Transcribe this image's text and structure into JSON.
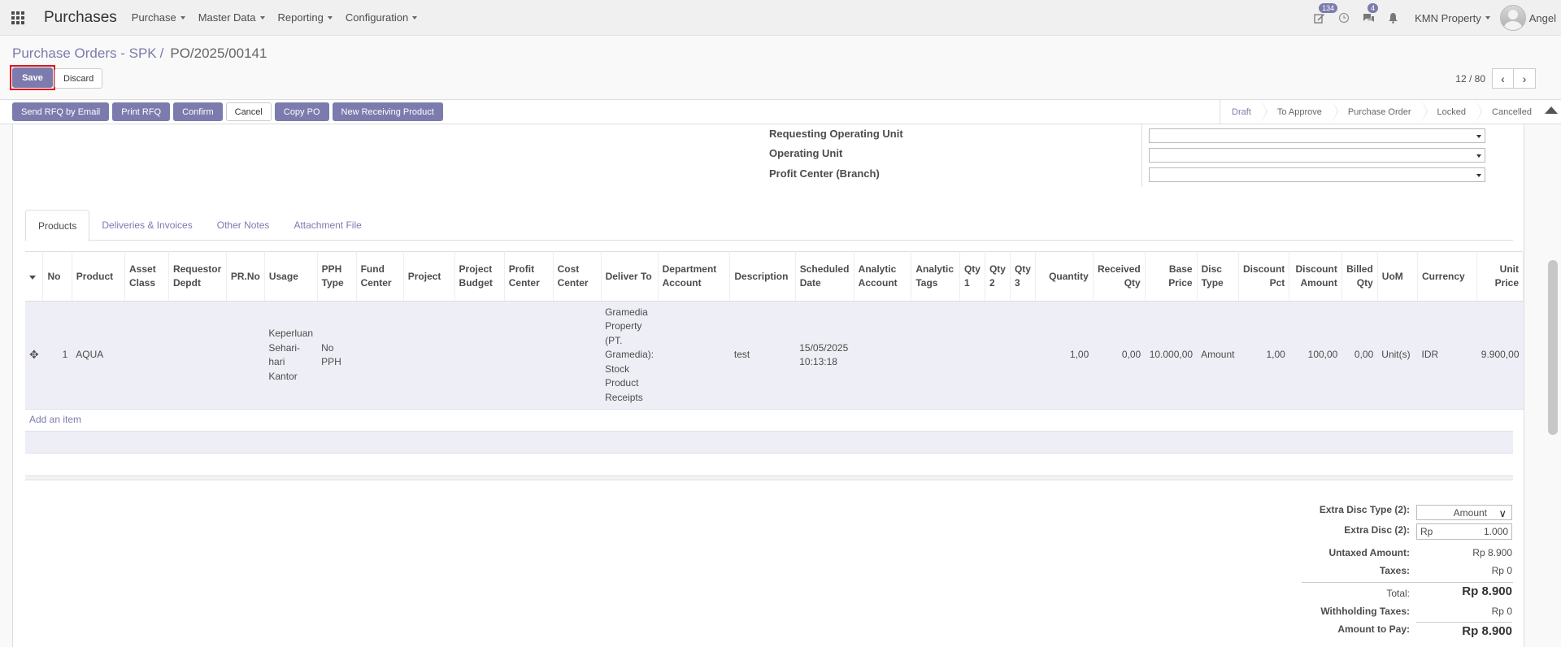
{
  "navbar": {
    "app_name": "Purchases",
    "menus": [
      "Purchase",
      "Master Data",
      "Reporting",
      "Configuration"
    ],
    "activity_badge": "134",
    "messages_badge": "4",
    "company": "KMN Property",
    "user": "Angel"
  },
  "breadcrumb": {
    "parent": "Purchase Orders - SPK",
    "separator": "/",
    "current": "PO/2025/00141"
  },
  "actions": {
    "save": "Save",
    "discard": "Discard"
  },
  "pager": {
    "value": "12 / 80"
  },
  "statusbar": {
    "buttons": [
      "Send RFQ by Email",
      "Print RFQ",
      "Confirm",
      "Cancel",
      "Copy PO",
      "New Receiving Product"
    ],
    "stages": [
      "Draft",
      "To Approve",
      "Purchase Order",
      "Locked",
      "Cancelled"
    ],
    "active_stage": "Draft"
  },
  "form": {
    "requesting_operating_unit": "Requesting Operating Unit",
    "operating_unit": "Operating Unit",
    "profit_center": "Profit Center (Branch)"
  },
  "tabs": [
    "Products",
    "Deliveries & Invoices",
    "Other Notes",
    "Attachment File"
  ],
  "lines": {
    "headers": [
      "No",
      "Product",
      "Asset Class",
      "Requestor Depdt",
      "PR.No",
      "Usage",
      "PPH Type",
      "Fund Center",
      "Project",
      "Project Budget",
      "Profit Center",
      "Cost Center",
      "Deliver To",
      "Department Account",
      "Description",
      "Scheduled Date",
      "Analytic Account",
      "Analytic Tags",
      "Qty 1",
      "Qty 2",
      "Qty 3",
      "Quantity",
      "Received Qty",
      "Base Price",
      "Disc Type",
      "Discount Pct",
      "Discount Amount",
      "Billed Qty",
      "UoM",
      "Currency",
      "Unit Price"
    ],
    "rows": [
      [
        "1",
        "AQUA",
        "",
        "",
        "",
        "Keperluan Sehari-hari Kantor",
        "No PPH",
        "",
        "",
        "",
        "",
        "",
        "Gramedia Property (PT. Gramedia): Stock Product Receipts",
        "",
        "test",
        "15/05/2025 10:13:18",
        "",
        "",
        "",
        "",
        "",
        "1,00",
        "0,00",
        "10.000,00",
        "Amount",
        "1,00",
        "100,00",
        "0,00",
        "Unit(s)",
        "IDR",
        "9.900,00"
      ]
    ],
    "add_item": "Add an item"
  },
  "totals": {
    "extra_disc_type_label": "Extra Disc Type (2):",
    "extra_disc_type_value": "Amount",
    "extra_disc_label": "Extra Disc (2):",
    "extra_disc_currency": "Rp",
    "extra_disc_value": "1.000",
    "untaxed_label": "Untaxed Amount:",
    "untaxed_value": "Rp 8.900",
    "taxes_label": "Taxes:",
    "taxes_value": "Rp 0",
    "total_label": "Total:",
    "total_value": "Rp 8.900",
    "withholding_label": "Withholding Taxes:",
    "withholding_value": "Rp 0",
    "amount_to_pay_label": "Amount to Pay:",
    "amount_to_pay_value": "Rp 8.900"
  },
  "colors": {
    "primary": "#7c7bad",
    "highlight_border": "#d9161f",
    "row_bg": "#eeeef6"
  }
}
